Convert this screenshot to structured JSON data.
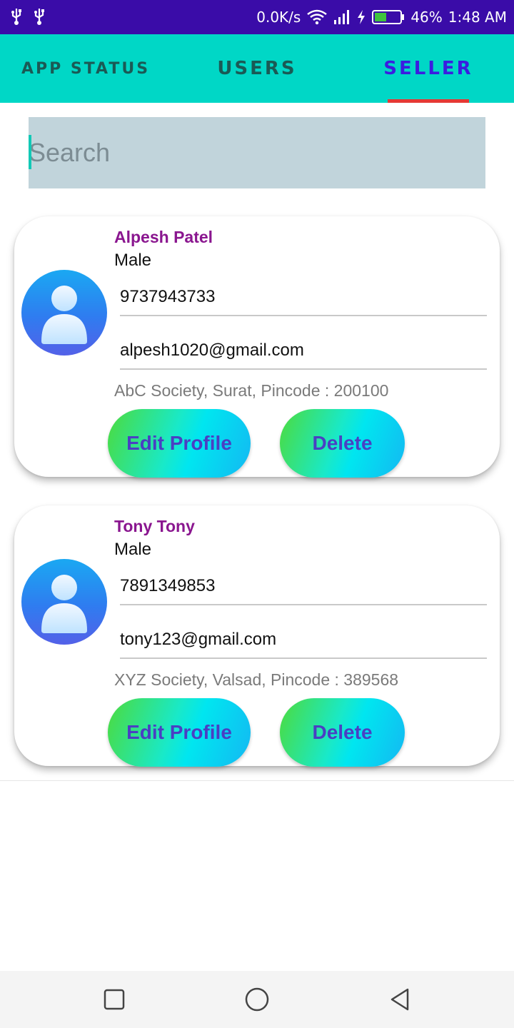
{
  "status_bar": {
    "network_speed": "0.0K/s",
    "battery_percent": "46%",
    "battery_level": 0.46,
    "time": "1:48 AM",
    "left_icons": [
      "usb-icon",
      "usb-icon"
    ],
    "right_icons": [
      "wifi-icon",
      "signal-icon",
      "charging-icon",
      "battery-icon"
    ]
  },
  "tabs": [
    {
      "label": "APP STATUS",
      "selected": false
    },
    {
      "label": "USERS",
      "selected": false
    },
    {
      "label": "SELLER",
      "selected": true
    }
  ],
  "search": {
    "placeholder": "Search",
    "value": ""
  },
  "sellers": [
    {
      "name": "Alpesh Patel",
      "gender": "Male",
      "phone": "9737943733",
      "email": "alpesh1020@gmail.com",
      "address": "AbC Society, Surat, Pincode : 200100",
      "edit_label": "Edit Profile",
      "delete_label": "Delete"
    },
    {
      "name": "Tony Tony",
      "gender": "Male",
      "phone": "7891349853",
      "email": "tony123@gmail.com",
      "address": "XYZ Society, Valsad, Pincode : 389568",
      "edit_label": "Edit Profile",
      "delete_label": "Delete"
    }
  ],
  "nav_bar": {
    "icons": [
      "recent-apps-icon",
      "home-icon",
      "back-icon"
    ]
  },
  "colors": {
    "status_bar": "#3a0ca8",
    "tab_bar": "#00d7c6",
    "tab_selected": "#3b1de0",
    "tab_indicator": "#e53935",
    "seller_name": "#8a168f",
    "button_text": "#4a3fc3"
  }
}
